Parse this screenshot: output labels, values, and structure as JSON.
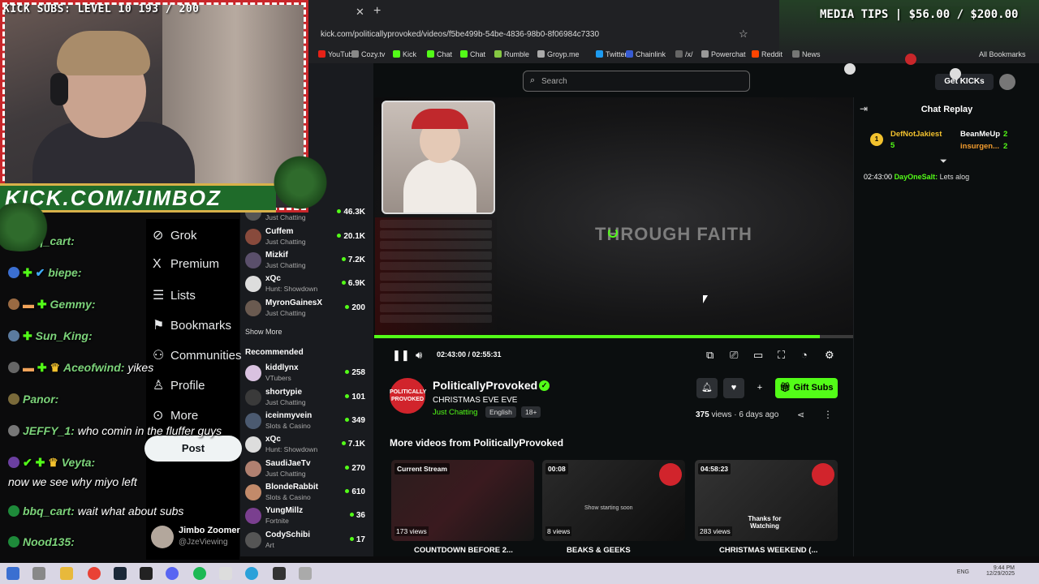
{
  "overlay": {
    "kick_subs": "KICK SUBS: LEVEL 10 193 / 200",
    "media_tips": "MEDIA TIPS | $56.00 / $200.00",
    "kick_banner": "KICK.COM/JIMBOZ"
  },
  "browser": {
    "url": "kick.com/politicallyprovoked/videos/f5be499b-54be-4836-98b0-8f06984c7330",
    "bookmarks": [
      "YouTube",
      "Cozy.tv",
      "Kick",
      "Chat",
      "Chat",
      "Rumble",
      "Groyp.me",
      "Twitter",
      "Chainlink",
      "/x/",
      "Powerchat",
      "Reddit",
      "News"
    ],
    "all_bookmarks": "All Bookmarks"
  },
  "left_chat": [
    {
      "name": "bbq_cart:",
      "message": ""
    },
    {
      "name": "biepe:",
      "message": ""
    },
    {
      "name": "Gemmy:",
      "message": ""
    },
    {
      "name": "Sun_King:",
      "message": ""
    },
    {
      "name": "Aceofwind:",
      "message": "yikes"
    },
    {
      "name": "Panor:",
      "message": ""
    },
    {
      "name": "JEFFY_1:",
      "message": "who comin in the fluffer guys"
    },
    {
      "name": "Veyta:",
      "message": ""
    },
    {
      "name": "",
      "message": "now we see why miyo left"
    },
    {
      "name": "bbq_cart:",
      "message": "wait what about subs"
    },
    {
      "name": "Nood135:",
      "message": ""
    }
  ],
  "x_sidebar": {
    "items": [
      "Grok",
      "Premium",
      "Lists",
      "Bookmarks",
      "Communities",
      "Profile",
      "More"
    ],
    "post": "Post",
    "account_name": "Jimbo Zoomer",
    "account_handle": "@JzeViewing"
  },
  "kick_sidebar": {
    "following": [
      {
        "name": "",
        "category": "Just Chatting",
        "viewers": "46.3K"
      },
      {
        "name": "Cuffem",
        "category": "Just Chatting",
        "viewers": "20.1K"
      },
      {
        "name": "Mizkif",
        "category": "Just Chatting",
        "viewers": "7.2K"
      },
      {
        "name": "xQc",
        "category": "Hunt: Showdown",
        "viewers": "6.9K"
      },
      {
        "name": "MyronGainesX",
        "category": "Just Chatting",
        "viewers": "200"
      }
    ],
    "show_more": "Show More",
    "recommended_label": "Recommended",
    "recommended": [
      {
        "name": "kiddlynx",
        "category": "VTubers",
        "viewers": "258"
      },
      {
        "name": "shortypie",
        "category": "Just Chatting",
        "viewers": "101"
      },
      {
        "name": "iceinmyvein",
        "category": "Slots & Casino",
        "viewers": "349"
      },
      {
        "name": "xQc",
        "category": "Hunt: Showdown",
        "viewers": "7.1K"
      },
      {
        "name": "SaudiJaeTv",
        "category": "Just Chatting",
        "viewers": "270"
      },
      {
        "name": "BlondeRabbit",
        "category": "Slots & Casino",
        "viewers": "610"
      },
      {
        "name": "YungMillz",
        "category": "Fortnite",
        "viewers": "36"
      },
      {
        "name": "CodySchibi",
        "category": "Art",
        "viewers": "17"
      }
    ]
  },
  "header": {
    "search_placeholder": "Search",
    "get_kicks": "Get KICKs"
  },
  "player": {
    "overlay_text": "THROUGH FAITH",
    "time": "02:43:00 / 02:55:31",
    "progress": 0.93
  },
  "channel": {
    "name": "PoliticallyProvoked",
    "logo_text": "POLITICALLY PROVOKED",
    "title": "CHRISTMAS EVE EVE",
    "category": "Just Chatting",
    "tags": [
      "English",
      "18+"
    ],
    "gift_subs": "Gift Subs",
    "views": "375",
    "views_label": "views",
    "posted": "6 days ago"
  },
  "more_videos": {
    "heading": "More videos from PoliticallyProvoked",
    "items": [
      {
        "badge": "Current Stream",
        "views": "173 views",
        "title": "COUNTDOWN BEFORE 2..."
      },
      {
        "badge": "00:08",
        "views": "8 views",
        "title": "BEAKS & GEEKS"
      },
      {
        "badge": "04:58:23",
        "views": "283 views",
        "title": "CHRISTMAS WEEKEND (..."
      }
    ],
    "thumb_text_2": "Show starting soon",
    "thumb_text_3": "Thanks for Watching"
  },
  "chat_replay": {
    "title": "Chat Replay",
    "leaders": [
      {
        "rank": "1",
        "name": "DefNotJakiest",
        "count": "5"
      },
      {
        "name": "BeanMeUp",
        "count": "2"
      },
      {
        "name": "insurgen...",
        "count": "2"
      }
    ],
    "messages": [
      {
        "time": "02:43:00",
        "user": "DayOneSalt:",
        "text": "Lets alog"
      }
    ]
  },
  "taskbar": {
    "lang": "ENG",
    "time": "9:44 PM",
    "date": "12/29/2025"
  },
  "colors": {
    "kick_green": "#53fc18",
    "bg": "#0b0e0f",
    "sidebar": "#191b1f"
  }
}
